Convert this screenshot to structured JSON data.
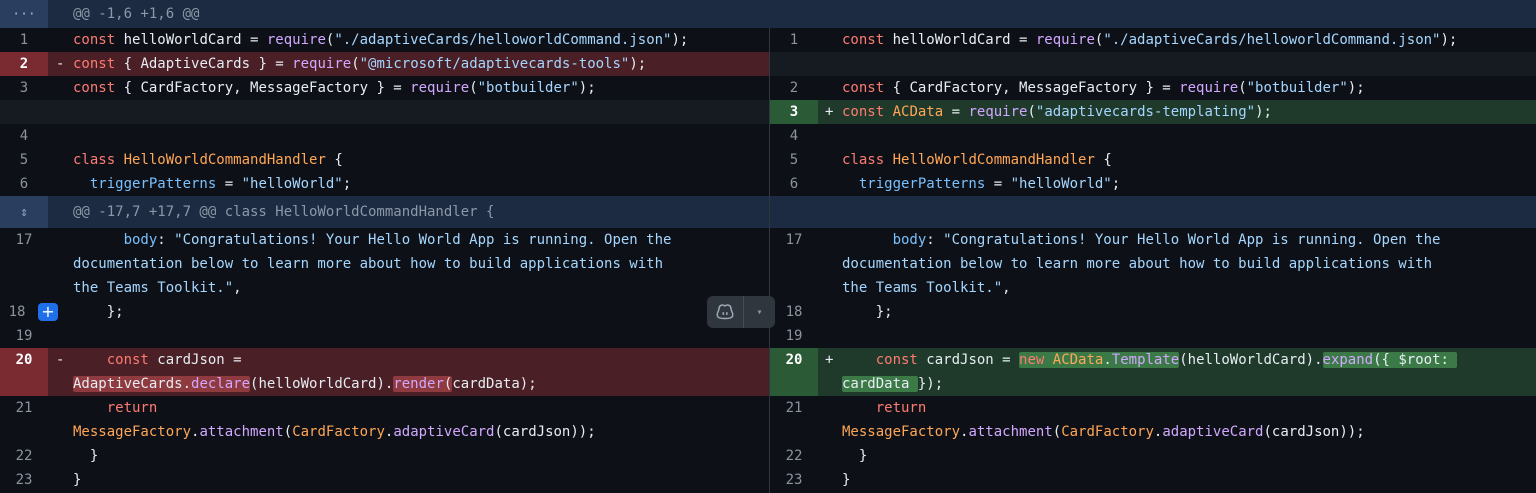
{
  "hunks": [
    {
      "expander": "···",
      "header": "@@ -1,6 +1,6 @@"
    },
    {
      "expander": "⇕",
      "header": "@@ -17,7 +17,7 @@ class HelloWorldCommandHandler {"
    }
  ],
  "left": {
    "lines": [
      {
        "num": "1",
        "mark": "",
        "code": "const helloWorldCard = require(\"./adaptiveCards/helloworldCommand.json\");"
      },
      {
        "num": "2",
        "mark": "-",
        "code": "const { AdaptiveCards } = require(\"@microsoft/adaptivecards-tools\");"
      },
      {
        "num": "3",
        "mark": "",
        "code": "const { CardFactory, MessageFactory } = require(\"botbuilder\");"
      },
      {
        "num": "4",
        "mark": "",
        "code": ""
      },
      {
        "num": "5",
        "mark": "",
        "code": "class HelloWorldCommandHandler {"
      },
      {
        "num": "6",
        "mark": "",
        "code": "  triggerPatterns = \"helloWorld\";"
      },
      {
        "num": "17",
        "mark": "",
        "code1": "      body: \"Congratulations! Your Hello World App is running. Open the",
        "code2": "documentation below to learn more about how to build applications with",
        "code3": "the Teams Toolkit.\","
      },
      {
        "num": "18",
        "mark": "",
        "code": "    };"
      },
      {
        "num": "19",
        "mark": "",
        "code": ""
      },
      {
        "num": "20",
        "mark": "-",
        "code1": "    const cardJson =",
        "code2": "AdaptiveCards.declare(helloWorldCard).render(cardData);"
      },
      {
        "num": "21",
        "mark": "",
        "code1": "    return",
        "code2": "MessageFactory.attachment(CardFactory.adaptiveCard(cardJson));"
      },
      {
        "num": "22",
        "mark": "",
        "code": "  }"
      },
      {
        "num": "23",
        "mark": "",
        "code": "}"
      }
    ]
  },
  "right": {
    "lines": [
      {
        "num": "1",
        "mark": "",
        "code": "const helloWorldCard = require(\"./adaptiveCards/helloworldCommand.json\");"
      },
      {
        "num": "2",
        "mark": "",
        "code": "const { CardFactory, MessageFactory } = require(\"botbuilder\");"
      },
      {
        "num": "3",
        "mark": "+",
        "code": "const ACData = require(\"adaptivecards-templating\");"
      },
      {
        "num": "4",
        "mark": "",
        "code": ""
      },
      {
        "num": "5",
        "mark": "",
        "code": "class HelloWorldCommandHandler {"
      },
      {
        "num": "6",
        "mark": "",
        "code": "  triggerPatterns = \"helloWorld\";"
      },
      {
        "num": "17",
        "mark": "",
        "code1": "      body: \"Congratulations! Your Hello World App is running. Open the",
        "code2": "documentation below to learn more about how to build applications with",
        "code3": "the Teams Toolkit.\","
      },
      {
        "num": "18",
        "mark": "",
        "code": "    };"
      },
      {
        "num": "19",
        "mark": "",
        "code": ""
      },
      {
        "num": "20",
        "mark": "+",
        "code1": "    const cardJson = new ACData.Template(helloWorldCard).expand({ $root:",
        "code2": "cardData });"
      },
      {
        "num": "21",
        "mark": "",
        "code1": "    return",
        "code2": "MessageFactory.attachment(CardFactory.adaptiveCard(cardJson));"
      },
      {
        "num": "22",
        "mark": "",
        "code": "  }"
      },
      {
        "num": "23",
        "mark": "",
        "code": "}"
      }
    ]
  },
  "buttons": {
    "add_comment": "+",
    "copilot_icon": "copilot-icon",
    "copilot_menu": "▾"
  }
}
